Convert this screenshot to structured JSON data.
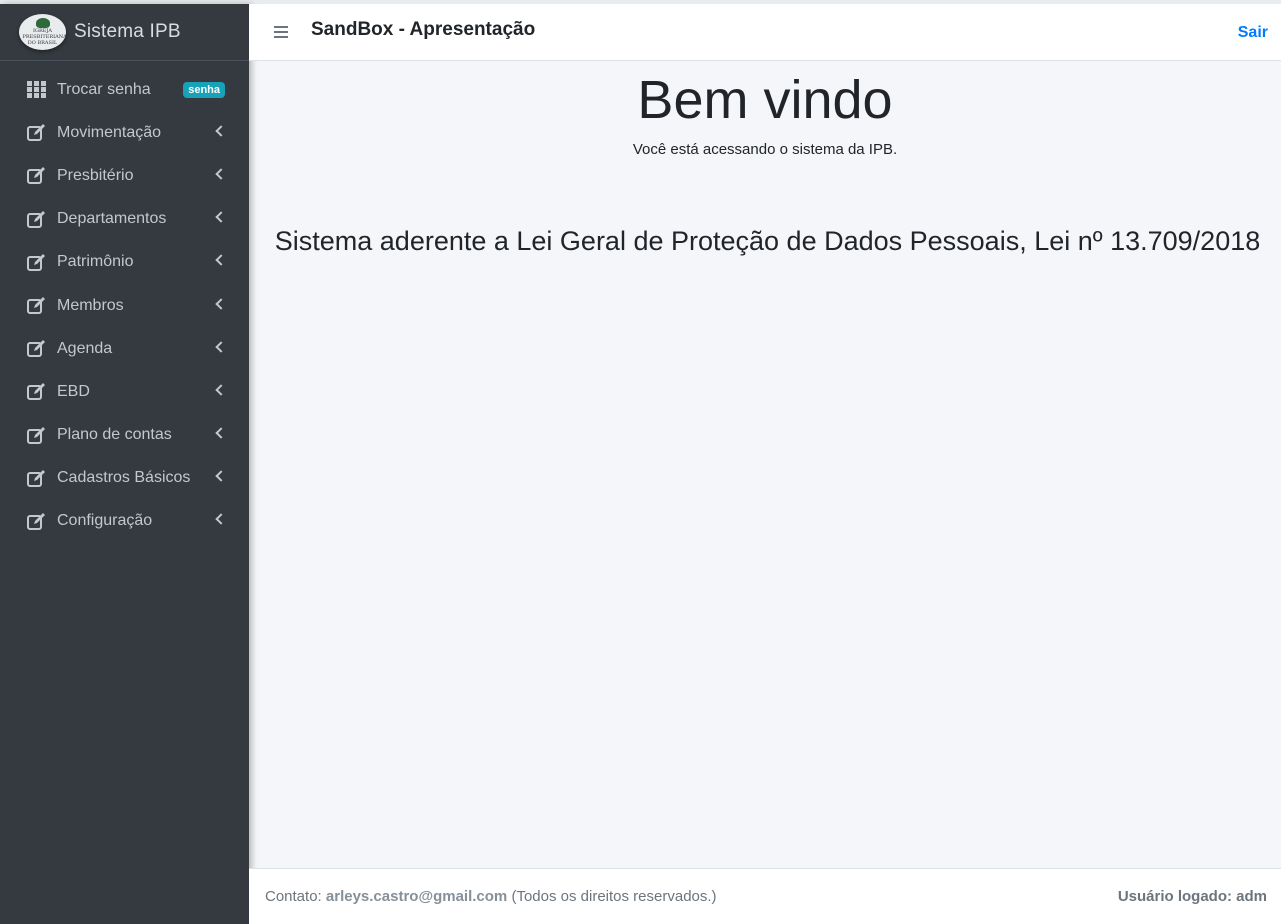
{
  "brand": {
    "name": "Sistema IPB",
    "logo_text": "IGREJA PRESBITERIANA DO BRASIL"
  },
  "header": {
    "title": "SandBox - Apresentação",
    "logout": "Sair"
  },
  "sidebar": {
    "items": [
      {
        "label": "Trocar senha",
        "icon": "grid-icon",
        "badge": "senha"
      },
      {
        "label": "Movimentação",
        "icon": "edit-icon"
      },
      {
        "label": "Presbitério",
        "icon": "edit-icon"
      },
      {
        "label": "Departamentos",
        "icon": "edit-icon"
      },
      {
        "label": "Patrimônio",
        "icon": "edit-icon"
      },
      {
        "label": "Membros",
        "icon": "edit-icon"
      },
      {
        "label": "Agenda",
        "icon": "edit-icon"
      },
      {
        "label": "EBD",
        "icon": "edit-icon"
      },
      {
        "label": "Plano de contas",
        "icon": "edit-icon"
      },
      {
        "label": "Cadastros Básicos",
        "icon": "edit-icon"
      },
      {
        "label": "Configuração",
        "icon": "edit-icon"
      }
    ]
  },
  "main": {
    "welcome": "Bem vindo",
    "subtitle": "Você está acessando o sistema da IPB.",
    "lgpd": "Sistema aderente a Lei Geral de Proteção de Dados Pessoais, Lei nº 13.709/2018"
  },
  "footer": {
    "contact_prefix": "Contato:",
    "email": "arleys.castro@gmail.com",
    "rights": "(Todos os direitos reservados.)",
    "user_label": "Usuário logado:",
    "user": "adm"
  },
  "colors": {
    "sidebar_bg": "#343a40",
    "accent": "#007bff",
    "badge": "#17a2b8",
    "content_bg": "#f4f6f9"
  }
}
